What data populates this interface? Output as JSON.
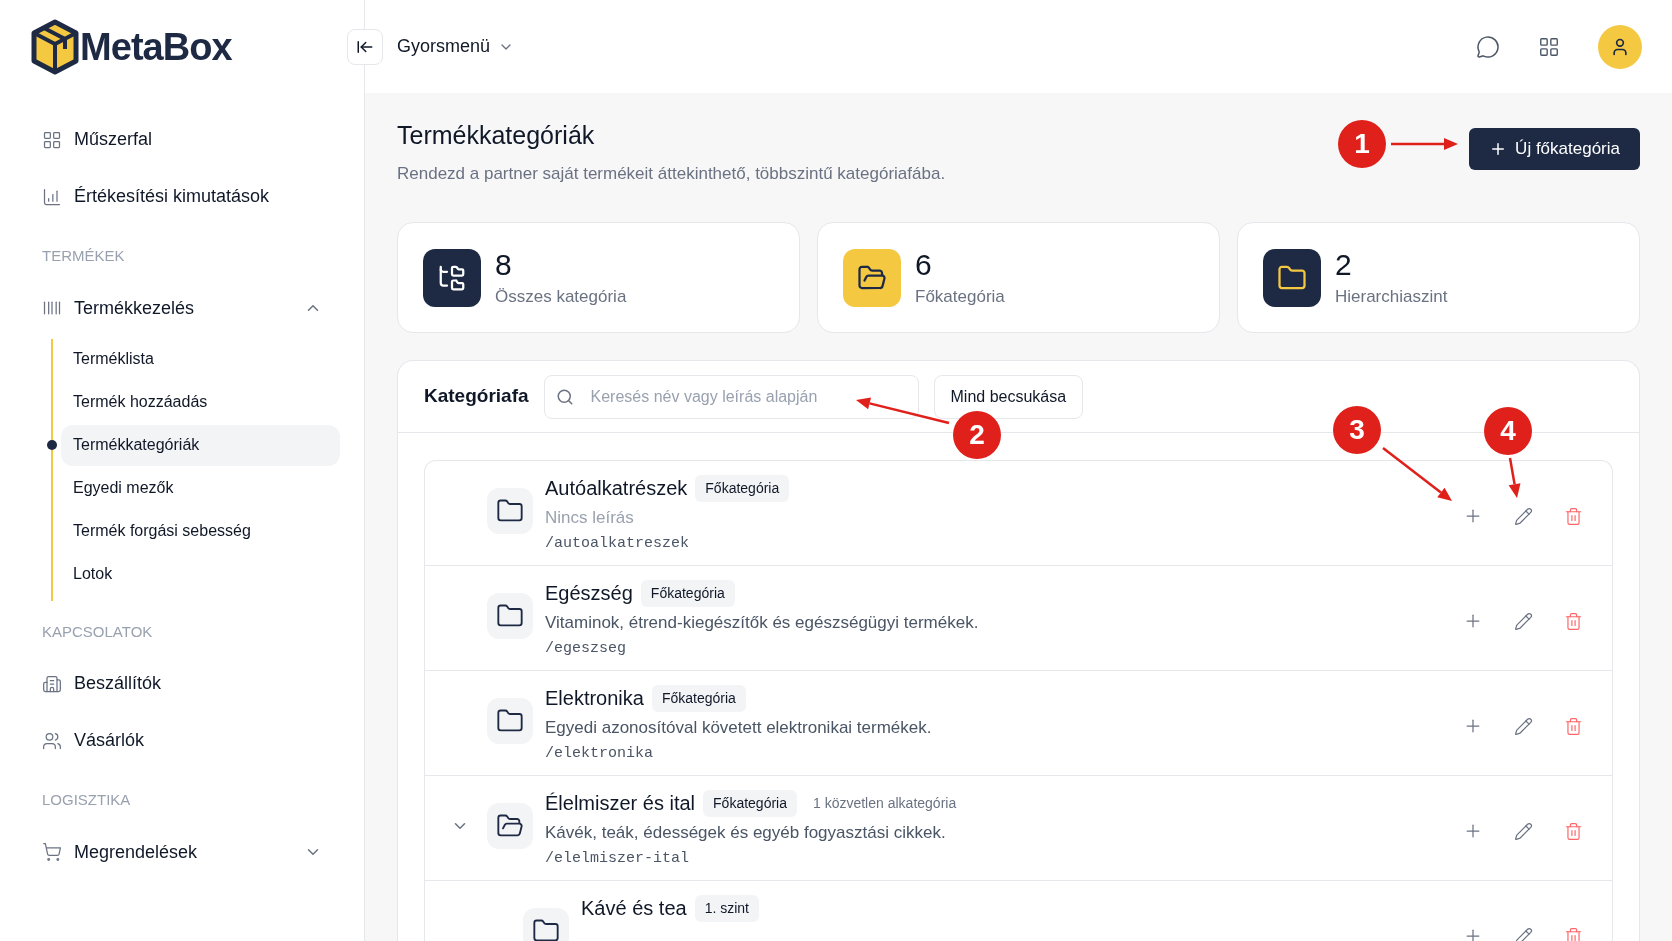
{
  "logo": {
    "text": "MetaBox"
  },
  "header": {
    "quick_menu": "Gyorsmenü"
  },
  "sidebar": [
    {
      "kind": "item",
      "label": "Műszerfal"
    },
    {
      "kind": "item",
      "label": "Értékesítési kimutatások"
    },
    {
      "kind": "heading",
      "label": "TERMÉKEK"
    },
    {
      "kind": "group",
      "label": "Termékkezelés",
      "expanded": true,
      "children": [
        {
          "label": "Terméklista",
          "selected": false
        },
        {
          "label": "Termék hozzáadás",
          "selected": false
        },
        {
          "label": "Termékkategóriák",
          "selected": true
        },
        {
          "label": "Egyedi mezők",
          "selected": false
        },
        {
          "label": "Termék forgási sebesség",
          "selected": false
        },
        {
          "label": "Lotok",
          "selected": false
        }
      ]
    },
    {
      "kind": "heading",
      "label": "KAPCSOLATOK"
    },
    {
      "kind": "item",
      "label": "Beszállítók"
    },
    {
      "kind": "item",
      "label": "Vásárlók"
    },
    {
      "kind": "heading",
      "label": "LOGISZTIKA"
    },
    {
      "kind": "group",
      "label": "Megrendelések",
      "expanded": false
    }
  ],
  "page": {
    "title": "Termékkategóriák",
    "subtitle": "Rendezd a partner saját termékeit áttekinthető, többszintű kategóriafába.",
    "primary_button": "Új főkategória"
  },
  "stats": [
    {
      "value": "8",
      "label": "Összes kategória"
    },
    {
      "value": "6",
      "label": "Főkategória"
    },
    {
      "value": "2",
      "label": "Hierarchiaszint"
    }
  ],
  "tree": {
    "title": "Kategóriafa",
    "search_placeholder": "Keresés név vagy leírás alapján",
    "collapse_button": "Mind becsukása",
    "rows": [
      {
        "name": "Autóalkatrészek",
        "badge": "Főkategória",
        "description": "Nincs leírás",
        "description_empty": true,
        "slug": "/autoalkatreszek"
      },
      {
        "name": "Egészség",
        "badge": "Főkategória",
        "description": "Vitaminok, étrend-kiegészítők és egészségügyi termékek.",
        "description_empty": false,
        "slug": "/egeszseg"
      },
      {
        "name": "Elektronika",
        "badge": "Főkategória",
        "description": "Egyedi azonosítóval követett elektronikai termékek.",
        "description_empty": false,
        "slug": "/elektronika"
      },
      {
        "name": "Élelmiszer és ital",
        "badge": "Főkategória",
        "subcount": "1 közvetlen alkategória",
        "description": "Kávék, teák, édességek és egyéb fogyasztási cikkek.",
        "description_empty": false,
        "slug": "/elelmiszer-ital",
        "expanded": true,
        "children": [
          {
            "name": "Kávé és tea",
            "badge": "1. szint"
          }
        ]
      }
    ]
  },
  "annotations": [
    {
      "label": "1"
    },
    {
      "label": "2"
    },
    {
      "label": "3"
    },
    {
      "label": "4"
    }
  ]
}
